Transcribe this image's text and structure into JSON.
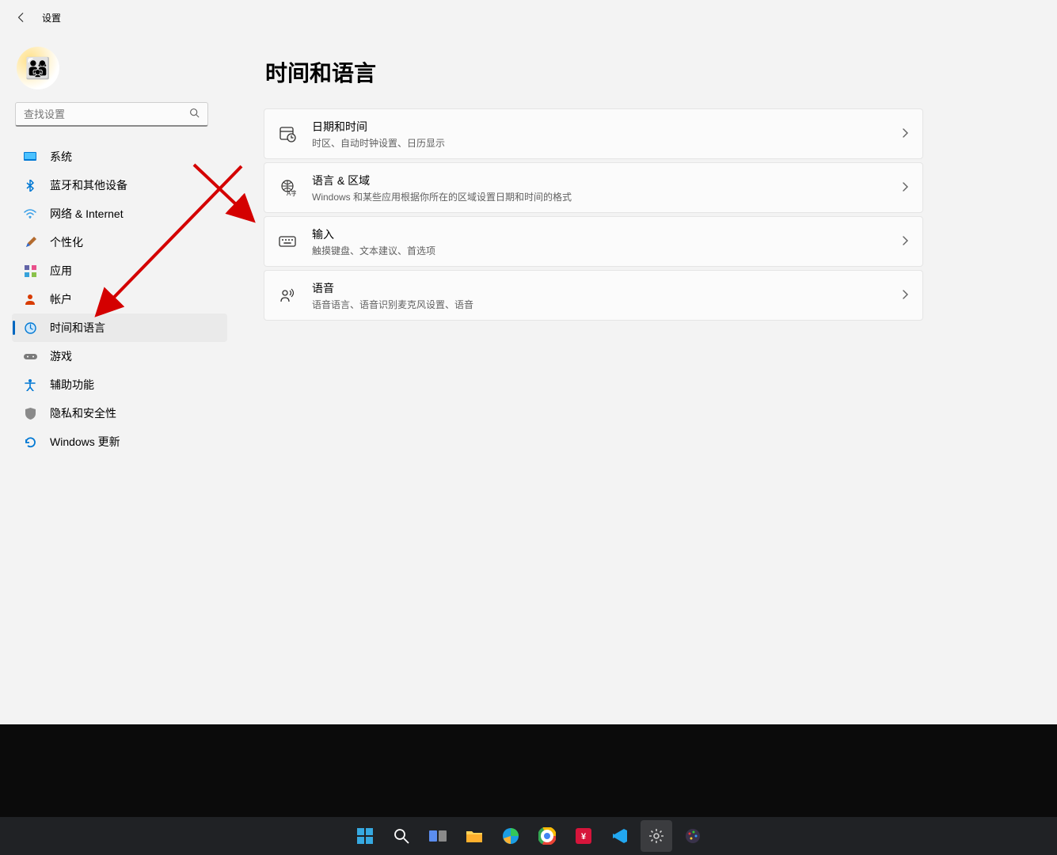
{
  "app_title": "设置",
  "search_placeholder": "查找设置",
  "page_title": "时间和语言",
  "sidebar": {
    "items": [
      {
        "label": "系统"
      },
      {
        "label": "蓝牙和其他设备"
      },
      {
        "label": "网络 & Internet"
      },
      {
        "label": "个性化"
      },
      {
        "label": "应用"
      },
      {
        "label": "帐户"
      },
      {
        "label": "时间和语言"
      },
      {
        "label": "游戏"
      },
      {
        "label": "辅助功能"
      },
      {
        "label": "隐私和安全性"
      },
      {
        "label": "Windows 更新"
      }
    ]
  },
  "cards": [
    {
      "title": "日期和时间",
      "desc": "时区、自动时钟设置、日历显示"
    },
    {
      "title": "语言 & 区域",
      "desc": "Windows 和某些应用根据你所在的区域设置日期和时间的格式"
    },
    {
      "title": "输入",
      "desc": "触摸键盘、文本建议、首选项"
    },
    {
      "title": "语音",
      "desc": "语音语言、语音识别麦克风设置、语音"
    }
  ]
}
